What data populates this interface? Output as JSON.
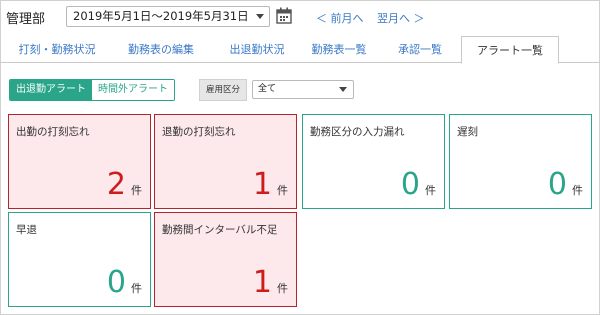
{
  "header": {
    "department": "管理部",
    "period": "2019年5月1日～2019年5月31日",
    "prev_link": "＜ 前月へ",
    "next_link": "翌月へ ＞"
  },
  "tabs": [
    {
      "label": "打刻・勤務状況",
      "active": false
    },
    {
      "label": "勤務表の編集",
      "active": false
    },
    {
      "label": "出退勤状況",
      "active": false
    },
    {
      "label": "勤務表一覧",
      "active": false
    },
    {
      "label": "承認一覧",
      "active": false
    },
    {
      "label": "アラート一覧",
      "active": true
    }
  ],
  "filters": {
    "toggle_on": "出退勤アラート",
    "toggle_off": "時間外アラート",
    "employment_label": "雇用区分",
    "employment_value": "全て"
  },
  "cards": [
    {
      "title": "出勤の打刻忘れ",
      "count": "2",
      "unit": "件",
      "status": "alert"
    },
    {
      "title": "退勤の打刻忘れ",
      "count": "1",
      "unit": "件",
      "status": "alert"
    },
    {
      "title": "勤務区分の入力漏れ",
      "count": "0",
      "unit": "件",
      "status": "ok"
    },
    {
      "title": "遅刻",
      "count": "0",
      "unit": "件",
      "status": "ok"
    },
    {
      "title": "早退",
      "count": "0",
      "unit": "件",
      "status": "ok"
    },
    {
      "title": "勤務間インターバル不足",
      "count": "1",
      "unit": "件",
      "status": "alert"
    }
  ],
  "colors": {
    "accent": "#2aa589",
    "alert_border": "#b2262b",
    "alert_bg": "#fde8ec",
    "alert_count": "#cc1c1c",
    "link": "#3a79c7"
  }
}
